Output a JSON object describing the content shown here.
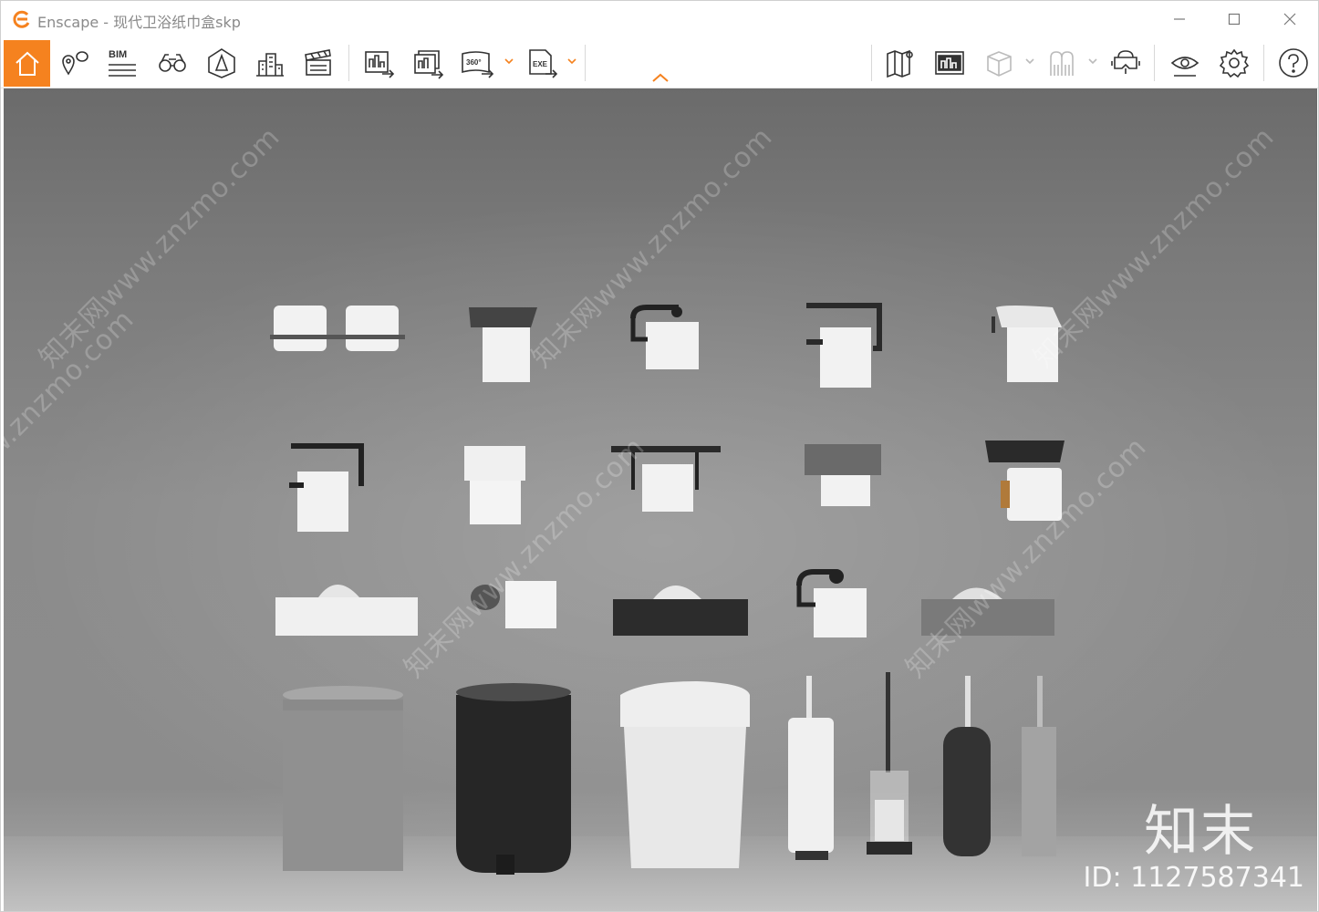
{
  "window": {
    "app_name": "Enscape",
    "title": "Enscape - 现代卫浴纸巾盒skp",
    "accent_color": "#f5821f"
  },
  "window_controls": [
    "minimize-icon",
    "maximize-icon",
    "close-icon"
  ],
  "toolbar": {
    "bim_label": "BIM",
    "video_360_label": "360°",
    "exe_label": "EXE",
    "left_tools": [
      "home-icon",
      "views-icon",
      "bim-mode-icon",
      "binoculars-icon",
      "asset-library-icon",
      "buildings-icon",
      "video-editor-icon"
    ],
    "export_tools": [
      "screenshot-export-icon",
      "batch-export-icon",
      "panorama-360-icon",
      "exe-export-icon"
    ],
    "right_tools": [
      "map-icon",
      "image-view-icon",
      "cube-icon",
      "people-icon",
      "vr-headset-icon",
      "visual-settings-icon",
      "settings-gear-icon",
      "help-icon"
    ]
  },
  "viewport": {
    "watermark_text": "知末网www.znzmo.com",
    "logo_text": "知末",
    "id_text": "ID: 1127587341"
  }
}
